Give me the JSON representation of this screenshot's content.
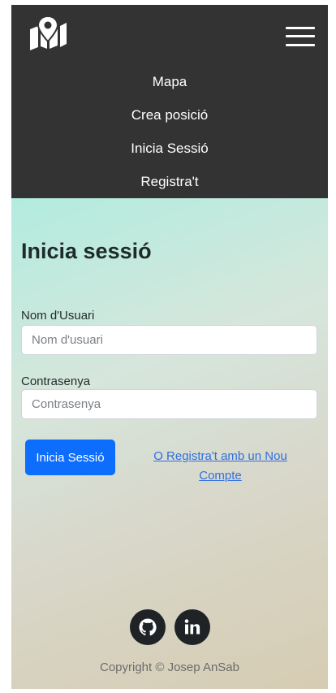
{
  "navbar": {
    "brand_icon": "map-pin-icon",
    "menu_icon": "hamburger-icon",
    "links": [
      "Mapa",
      "Crea posició",
      "Inicia Sessió",
      "Registra't"
    ]
  },
  "login": {
    "title": "Inicia sessió",
    "username_label": "Nom d'Usuari",
    "username_placeholder": "Nom d'usuari",
    "username_value": "",
    "password_label": "Contrasenya",
    "password_placeholder": "Contrasenya",
    "password_value": "",
    "submit_label": "Inicia Sessió",
    "register_link": "O Registra't amb un Nou Compte"
  },
  "footer": {
    "social": [
      "github-icon",
      "linkedin-icon"
    ],
    "copyright": "Copyright © Josep AnSab"
  },
  "colors": {
    "navbar_bg": "#333333",
    "primary": "#0d6efd",
    "link": "#2f6fe0",
    "social_bg": "#1f2326"
  }
}
